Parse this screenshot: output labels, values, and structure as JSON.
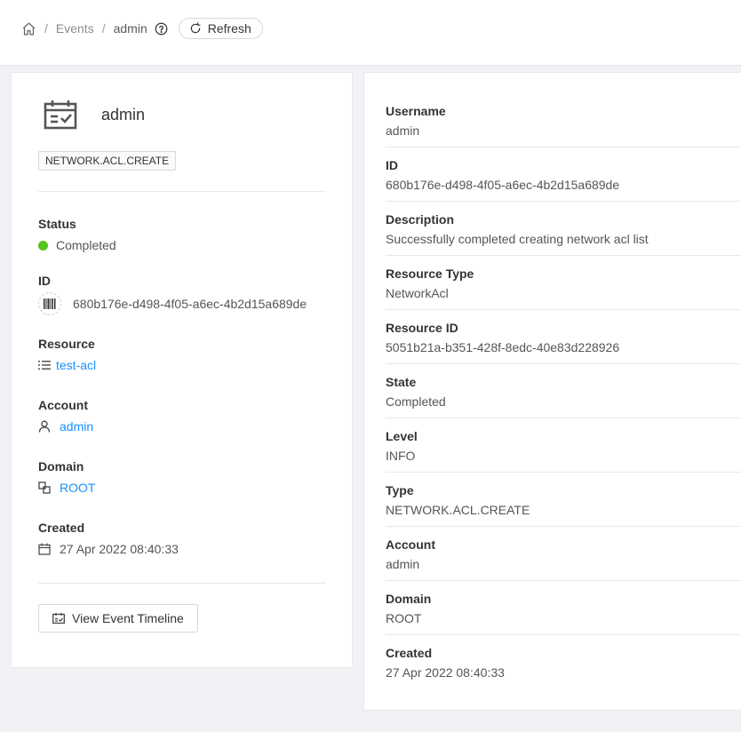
{
  "breadcrumb": {
    "home_icon": "home-icon",
    "separator": "/",
    "events": "Events",
    "current": "admin",
    "help_icon": "question-circle-icon"
  },
  "toolbar": {
    "refresh_label": "Refresh",
    "refresh_icon": "reload-icon"
  },
  "summary": {
    "icon": "calendar-check-icon",
    "title": "admin",
    "type_tag": "NETWORK.ACL.CREATE",
    "status": {
      "label": "Status",
      "value": "Completed",
      "color": "#52c41a"
    },
    "id": {
      "label": "ID",
      "value": "680b176e-d498-4f05-a6ec-4b2d15a689de",
      "icon": "barcode-icon"
    },
    "resource": {
      "label": "Resource",
      "value": "test-acl",
      "icon": "unordered-list-icon"
    },
    "account": {
      "label": "Account",
      "value": "admin",
      "icon": "user-icon"
    },
    "domain": {
      "label": "Domain",
      "value": "ROOT",
      "icon": "block-icon"
    },
    "created": {
      "label": "Created",
      "value": "27 Apr 2022 08:40:33",
      "icon": "calendar-icon"
    },
    "timeline_button": "View Event Timeline"
  },
  "details": [
    {
      "label": "Username",
      "value": "admin"
    },
    {
      "label": "ID",
      "value": "680b176e-d498-4f05-a6ec-4b2d15a689de"
    },
    {
      "label": "Description",
      "value": "Successfully completed creating network acl list"
    },
    {
      "label": "Resource Type",
      "value": "NetworkAcl"
    },
    {
      "label": "Resource ID",
      "value": "5051b21a-b351-428f-8edc-40e83d228926"
    },
    {
      "label": "State",
      "value": "Completed"
    },
    {
      "label": "Level",
      "value": "INFO"
    },
    {
      "label": "Type",
      "value": "NETWORK.ACL.CREATE"
    },
    {
      "label": "Account",
      "value": "admin"
    },
    {
      "label": "Domain",
      "value": "ROOT"
    },
    {
      "label": "Created",
      "value": "27 Apr 2022 08:40:33"
    }
  ],
  "colors": {
    "link": "#1890ff",
    "status_success": "#52c41a"
  }
}
